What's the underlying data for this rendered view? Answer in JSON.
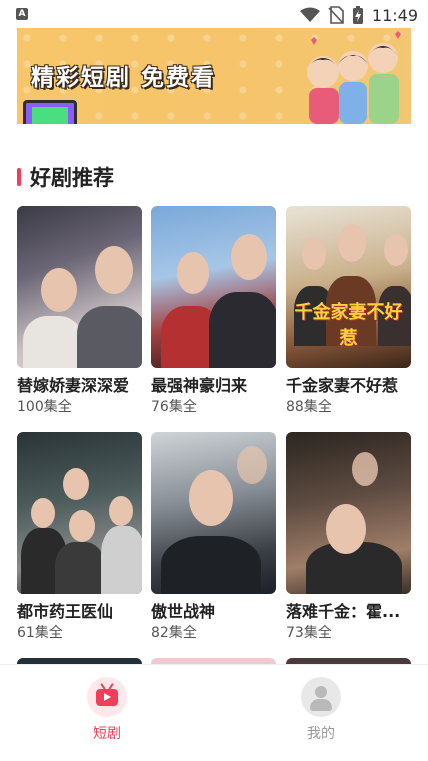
{
  "status_bar": {
    "time": "11:49",
    "icons": [
      "app-notification-icon",
      "wifi-icon",
      "no-sim-icon",
      "battery-charging-icon"
    ]
  },
  "banner": {
    "text": "精彩短剧 免费看"
  },
  "section": {
    "title": "好剧推荐"
  },
  "dramas": [
    {
      "title": "替嫁娇妻深深爱",
      "episodes": "100集全"
    },
    {
      "title": "最强神豪归来",
      "episodes": "76集全"
    },
    {
      "title": "千金家妻不好惹",
      "episodes": "88集全",
      "poster_text": "千金家妻不好惹"
    },
    {
      "title": "都市药王医仙",
      "episodes": "61集全"
    },
    {
      "title": "傲世战神",
      "episodes": "82集全"
    },
    {
      "title": "落难千金：霍...",
      "episodes": "73集全"
    }
  ],
  "tab_bar": {
    "tabs": [
      {
        "label": "短剧",
        "icon": "tv-play-icon",
        "active": true
      },
      {
        "label": "我的",
        "icon": "user-avatar-icon",
        "active": false
      }
    ],
    "active_color": "#ef3f5a",
    "inactive_color": "#999999"
  }
}
